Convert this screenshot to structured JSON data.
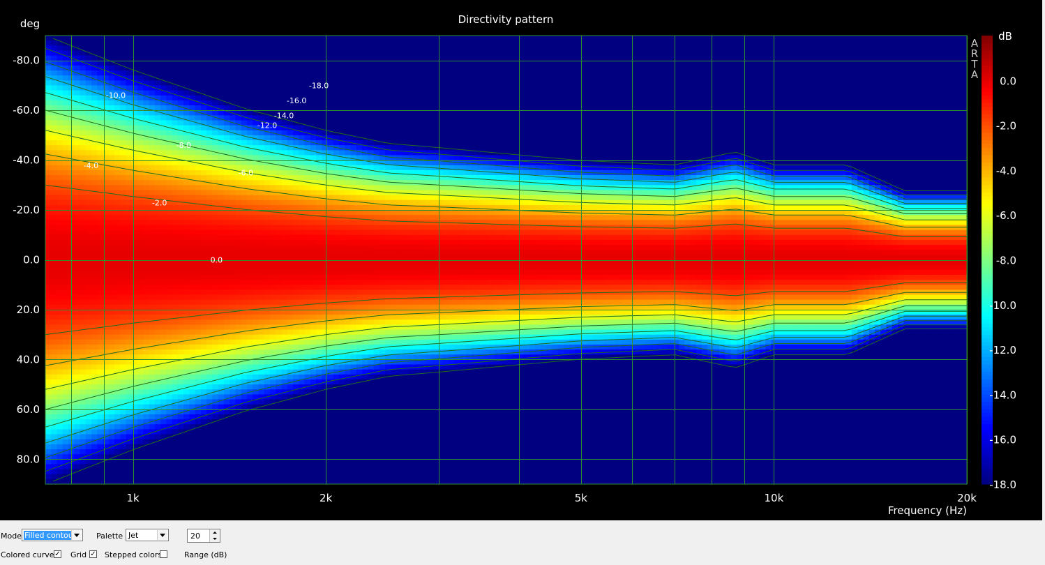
{
  "chart_data": {
    "type": "heatmap",
    "title": "Directivity pattern",
    "xlabel": "Frequency (Hz)",
    "ylabel": "deg",
    "x_scale": "log",
    "xlim": [
      730,
      20000
    ],
    "ylim": [
      -90,
      90
    ],
    "x_ticks": [
      1000,
      2000,
      5000,
      10000,
      20000
    ],
    "x_tick_labels": [
      "1k",
      "2k",
      "5k",
      "10k",
      "20k"
    ],
    "x_minor_grid": [
      800,
      900,
      3000,
      4000,
      6000,
      7000,
      8000,
      9000
    ],
    "y_ticks": [
      -80,
      -60,
      -40,
      -20,
      0,
      20,
      40,
      60,
      80
    ],
    "y_tick_labels": [
      "-80.0",
      "-60.0",
      "-40.0",
      "-20.0",
      "0.0",
      "20.0",
      "40.0",
      "60.0",
      "80.0"
    ],
    "grid": true,
    "palette": "Jet",
    "colorbar": {
      "unit": "dB",
      "range": [
        -18,
        2
      ],
      "ticks": [
        0,
        -2,
        -4,
        -6,
        -8,
        -10,
        -12,
        -14,
        -16,
        -18
      ],
      "tick_labels": [
        "0.0",
        "-2.0",
        "-4.0",
        "-6.0",
        "-8.0",
        "-10.0",
        "-12.0",
        "-14.0",
        "-16.0",
        "-18.0"
      ]
    },
    "contour_levels": [
      -2,
      -4,
      -6,
      -8,
      -10,
      -12,
      -14,
      -16,
      -18
    ],
    "beamwidth_6dB_half_angle": [
      {
        "freq": 730,
        "deg": 52
      },
      {
        "freq": 1000,
        "deg": 44
      },
      {
        "freq": 1500,
        "deg": 35
      },
      {
        "freq": 2000,
        "deg": 30
      },
      {
        "freq": 2500,
        "deg": 27
      },
      {
        "freq": 3000,
        "deg": 26
      },
      {
        "freq": 5000,
        "deg": 23
      },
      {
        "freq": 7000,
        "deg": 22
      },
      {
        "freq": 8700,
        "deg": 25
      },
      {
        "freq": 10000,
        "deg": 22
      },
      {
        "freq": 13000,
        "deg": 22
      },
      {
        "freq": 16000,
        "deg": 16
      },
      {
        "freq": 20000,
        "deg": 16
      }
    ],
    "contour_labels": [
      {
        "text": "-18.0",
        "freq": 1950,
        "deg": -70
      },
      {
        "text": "-16.0",
        "freq": 1800,
        "deg": -64
      },
      {
        "text": "-14.0",
        "freq": 1720,
        "deg": -58
      },
      {
        "text": "-12.0",
        "freq": 1620,
        "deg": -54
      },
      {
        "text": "-10.0",
        "freq": 940,
        "deg": -66
      },
      {
        "text": "-8.0",
        "freq": 1200,
        "deg": -46
      },
      {
        "text": "-6.0",
        "freq": 1500,
        "deg": -35
      },
      {
        "text": "-4.0",
        "freq": 860,
        "deg": -38
      },
      {
        "text": "-2.0",
        "freq": 1100,
        "deg": -23
      },
      {
        "text": "0.0",
        "freq": 1350,
        "deg": 0
      }
    ],
    "watermark": [
      "A",
      "R",
      "T",
      "A"
    ]
  },
  "controls": {
    "mode_label": "Mode",
    "mode_value": "Filled contour",
    "palette_label": "Palette",
    "palette_value": "Jet",
    "range_value": "20",
    "range_label": "Range (dB)",
    "colored_curves_label": "Colored curves",
    "colored_curves_checked": true,
    "grid_label": "Grid",
    "grid_checked": true,
    "stepped_colors_label": "Stepped colors",
    "stepped_colors_checked": false,
    "checkmark": "✓"
  }
}
